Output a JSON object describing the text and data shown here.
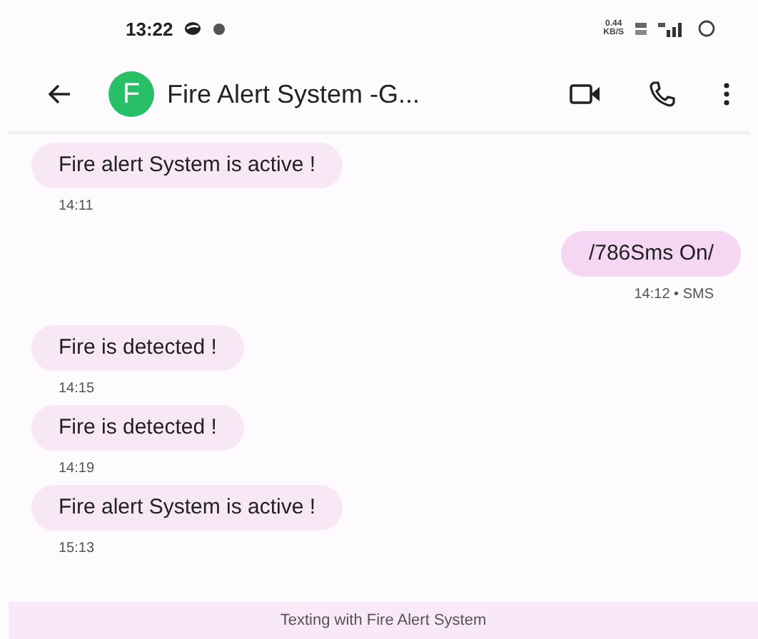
{
  "status_bar": {
    "time": "13:22",
    "net_speed": "0.44",
    "net_unit": "KB/S"
  },
  "header": {
    "avatar_letter": "F",
    "title": "Fire Alert System -G..."
  },
  "messages": [
    {
      "kind": "incoming",
      "text": "Fire alert System is active !",
      "meta": "14:11"
    },
    {
      "kind": "outgoing",
      "text": "/786Sms On/",
      "meta": "14:12 • SMS"
    },
    {
      "kind": "incoming",
      "text": "Fire is detected !",
      "meta": "14:15"
    },
    {
      "kind": "incoming",
      "text": "Fire is detected !",
      "meta": "14:19"
    },
    {
      "kind": "incoming",
      "text": "Fire alert System is active !",
      "meta": "15:13"
    }
  ],
  "footer": {
    "text": "Texting with Fire Alert System"
  }
}
